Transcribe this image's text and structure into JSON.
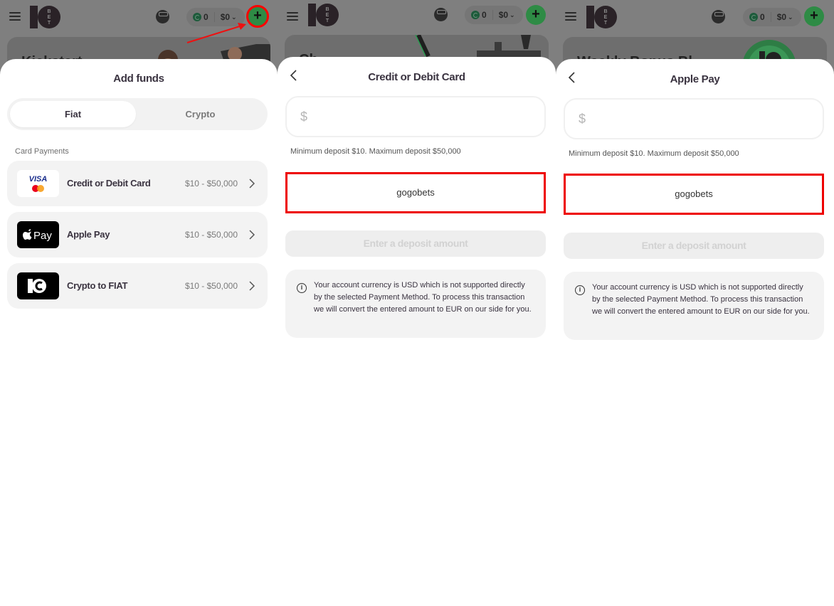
{
  "header": {
    "menu_icon": "hamburger-icon",
    "logo_text": "10BET",
    "coin_balance": "0",
    "cash_balance": "$0",
    "add_funds_icon": "plus-icon"
  },
  "colors": {
    "accent_green": "#2e8b45",
    "highlight_red": "#ee0000",
    "sheet_bg": "#ffffff",
    "card_bg": "#f3f3f3"
  },
  "panels": [
    {
      "banner_title": "Kickstart",
      "sheet": {
        "title": "Add funds",
        "tabs": [
          {
            "label": "Fiat",
            "active": true
          },
          {
            "label": "Crypto",
            "active": false
          }
        ],
        "section_label": "Card Payments",
        "methods": [
          {
            "name": "Credit or Debit Card",
            "range": "$10 - $50,000",
            "logo": "visa-mastercard-logo",
            "logo_text": "VISA"
          },
          {
            "name": "Apple Pay",
            "range": "$10 - $50,000",
            "logo": "apple-pay-logo",
            "logo_text": "Pay"
          },
          {
            "name": "Crypto to FIAT",
            "range": "$10 - $50,000",
            "logo": "10bet-crypto-logo",
            "logo_text": ""
          }
        ]
      }
    },
    {
      "banner_title": "Ch",
      "sheet": {
        "title": "Credit or Debit Card",
        "currency_symbol": "$",
        "amount_value": "",
        "limits_text": "Minimum deposit $10. Maximum deposit $50,000",
        "promo_text": "gogobets",
        "submit_label": "Enter a deposit amount",
        "info_text": "Your account currency is USD which is not supported directly by the selected Payment Method. To process this transaction we will convert the entered amount to EUR on our side for you."
      }
    },
    {
      "banner_title": "Weekly Bonus Bl",
      "sheet": {
        "title": "Apple Pay",
        "currency_symbol": "$",
        "amount_value": "",
        "limits_text": "Minimum deposit $10. Maximum deposit $50,000",
        "promo_text": "gogobets",
        "submit_label": "Enter a deposit amount",
        "info_text": "Your account currency is USD which is not supported directly by the selected Payment Method. To process this transaction we will convert the entered amount to EUR on our side for you."
      }
    }
  ]
}
